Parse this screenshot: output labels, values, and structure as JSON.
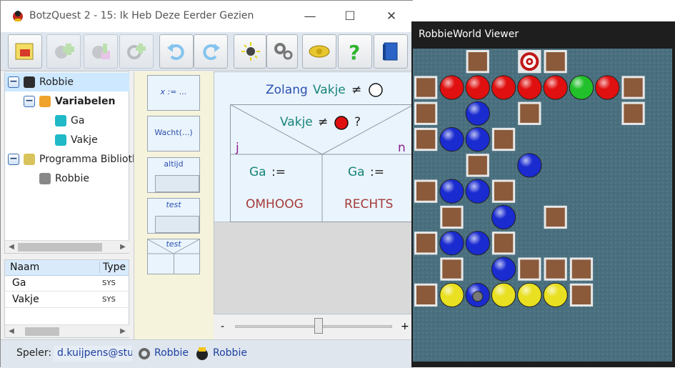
{
  "window": {
    "title": "BotzQuest 2 - 15: Ik Heb Deze Eerder Gezien",
    "minimize": "—",
    "maximize": "☐",
    "close": "✕"
  },
  "toolbar": {
    "icons": [
      "eraser-icon",
      "add-robot-icon",
      "add-library-icon",
      "add-gear-icon",
      "undo-icon",
      "redo-icon",
      "run-icon",
      "settings-gears-icon",
      "badge-icon",
      "help-icon",
      "book-icon"
    ]
  },
  "tree": {
    "items": [
      {
        "label": "Robbie",
        "level": 0,
        "expander": "−",
        "icon": "robot-icon"
      },
      {
        "label": "Variabelen",
        "level": 1,
        "expander": "−",
        "icon": "folder-icon",
        "bold": true
      },
      {
        "label": "Ga",
        "level": 2,
        "icon": "variable-icon"
      },
      {
        "label": "Vakje",
        "level": 2,
        "icon": "variable-icon"
      },
      {
        "label": "Programma Bibliotheek",
        "level": 0,
        "expander": "−",
        "icon": "library-icon"
      },
      {
        "label": "Robbie",
        "level": 1,
        "icon": "gear-icon"
      }
    ]
  },
  "vars": {
    "headers": {
      "name": "Naam",
      "type": "Type"
    },
    "rows": [
      {
        "name": "Ga",
        "type": "SYS"
      },
      {
        "name": "Vakje",
        "type": "SYS"
      }
    ]
  },
  "palette": {
    "assign": "x := ...",
    "wait": "Wacht(...)",
    "forever": "altijd",
    "test1": "test",
    "test2": "test"
  },
  "editor": {
    "loop": {
      "keyword": "Zolang",
      "var": "Vakje",
      "op": "≠"
    },
    "cond": {
      "var": "Vakje",
      "op": "≠",
      "q": "?",
      "yes": "j",
      "no": "n"
    },
    "left": {
      "var": "Ga",
      "assign": ":=",
      "value": "OMHOOG"
    },
    "right": {
      "var": "Ga",
      "assign": ":=",
      "value": "RECHTS"
    }
  },
  "zoom": {
    "minus": "-",
    "plus": "+",
    "level": 0.53
  },
  "status": {
    "player_label": "Speler:",
    "player": "d.kuijpens@stu",
    "prog": "Robbie",
    "robot": "Robbie"
  },
  "viewer": {
    "title": "RobbieWorld Viewer"
  },
  "colors": {
    "red": "#e01010",
    "blue": "#1a2bd0",
    "green": "#22c02a",
    "yellow": "#e8e020",
    "wall": "#8a5a3a",
    "bg": "#4a6f7e"
  },
  "grid": {
    "cols": 10,
    "rows": 10,
    "cells": [
      "..W.TW....",
      "WRRRRRGRW.",
      "W.B.W...W.",
      "WBBW......",
      "..W.B.....",
      "WBBW......",
      ".W.B.W....",
      "WBBW......",
      ".W.BWWW...",
      "WYKYYYW..."
    ]
  }
}
